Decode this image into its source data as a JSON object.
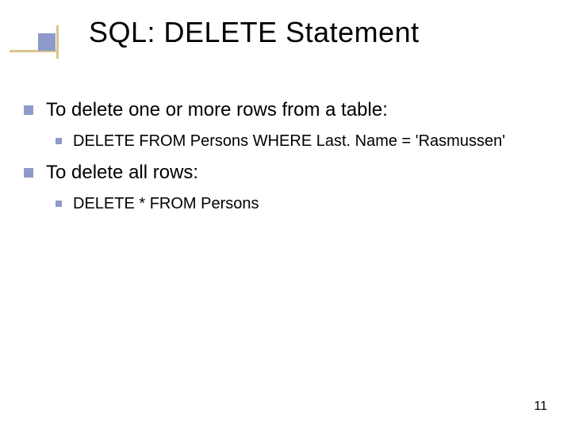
{
  "title": "SQL: DELETE Statement",
  "bullets": {
    "item1": "To delete one or more rows from a table:",
    "item1_sub": "DELETE FROM Persons WHERE Last. Name = 'Rasmussen'",
    "item2": "To delete all rows:",
    "item2_sub": "DELETE * FROM Persons"
  },
  "page_number": "11"
}
